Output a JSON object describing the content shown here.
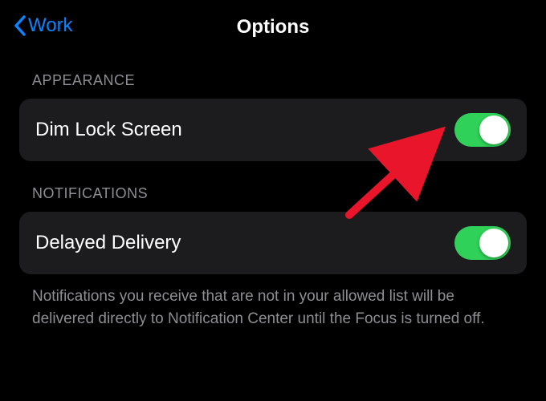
{
  "header": {
    "back_label": "Work",
    "title": "Options"
  },
  "sections": {
    "appearance": {
      "header": "APPEARANCE",
      "dim_lock_screen": {
        "label": "Dim Lock Screen",
        "enabled": true
      }
    },
    "notifications": {
      "header": "NOTIFICATIONS",
      "delayed_delivery": {
        "label": "Delayed Delivery",
        "enabled": true
      },
      "footer": "Notifications you receive that are not in your allowed list will be delivered directly to Notification Center until the Focus is turned off."
    }
  },
  "colors": {
    "accent": "#0a84ff",
    "toggle_on": "#30d158",
    "row_bg": "#1c1c1e",
    "secondary_text": "#8e8e93"
  },
  "annotation": {
    "type": "arrow",
    "color": "#e8152b",
    "points_to": "dim-lock-screen-toggle"
  }
}
